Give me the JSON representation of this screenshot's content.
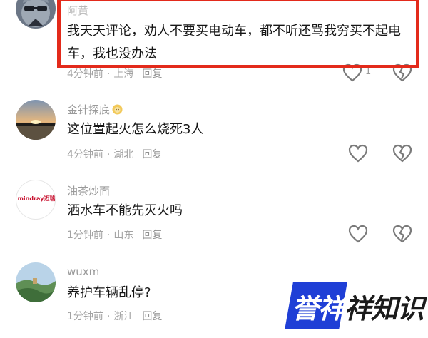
{
  "comments": [
    {
      "username": "阿黄",
      "text": "我天天评论，劝人不要买电动车，都不听还骂我穷买不起电车，我也没办法",
      "time": "4分钟前",
      "location": "上海",
      "reply": "回复",
      "likes": "1",
      "avatar": "cat-with-sunglasses"
    },
    {
      "username": "金针探底",
      "text": "这位置起火怎么烧死3人",
      "time": "4分钟前",
      "location": "湖北",
      "reply": "回复",
      "avatar": "sunset-landscape"
    },
    {
      "username": "油茶炒面",
      "text": "洒水车不能先灭火吗",
      "time": "1分钟前",
      "location": "山东",
      "reply": "回复",
      "avatar": "mindray-logo",
      "avatar_text": "mindray迈瑞"
    },
    {
      "username": "wuxm",
      "text": "养护车辆乱停?",
      "time": "1分钟前",
      "location": "浙江",
      "reply": "回复",
      "avatar": "green-scenery"
    }
  ],
  "separator": "·",
  "watermark": {
    "part1": "誉祥",
    "part2": "祥知识"
  },
  "colors": {
    "highlight": "#e32a1b",
    "watermark_blue": "#1f3fd6"
  }
}
